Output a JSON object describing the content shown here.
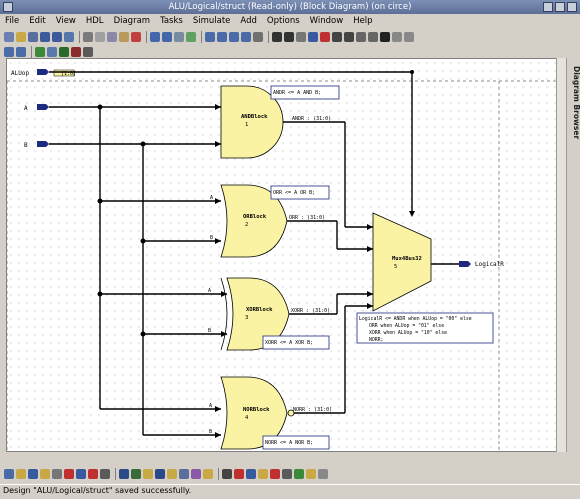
{
  "window": {
    "title": "ALU/Logical/struct (Read-only) (Block Diagram) (on circe)"
  },
  "menu": [
    "File",
    "Edit",
    "View",
    "HDL",
    "Diagram",
    "Tasks",
    "Simulate",
    "Add",
    "Options",
    "Window",
    "Help"
  ],
  "side_panel": {
    "label": "Diagram Browser"
  },
  "diagram": {
    "ports": {
      "aluop": {
        "label": "ALUop",
        "width": "[1:0]"
      },
      "a": {
        "label": "A"
      },
      "b": {
        "label": "B"
      },
      "out": {
        "label": "LogicalR"
      }
    },
    "blocks": [
      {
        "name": "ANDBlock",
        "num": "1",
        "out": "ANDR : (31:0)",
        "eq": "ANDR <= A AND B;"
      },
      {
        "name": "ORBlock",
        "num": "2",
        "out": "ORR : (31:0)",
        "eq": "ORR <= A OR B;"
      },
      {
        "name": "XORBlock",
        "num": "3",
        "out": "XORR : (31:0)",
        "eq": "XORR <= A XOR B;"
      },
      {
        "name": "NORBlock",
        "num": "4",
        "out": "NORR : (31:0)",
        "eq": "NORR <= A NOR B;"
      }
    ],
    "mux": {
      "name": "Mux4Bus32",
      "num": "5"
    },
    "pin_labels": {
      "a": "A",
      "b": "B"
    },
    "mux_code": [
      "LogicalR <= ANDR when ALUop = \"00\" else",
      "ORR when ALUop = \"01\" else",
      "XORR when ALUop = \"10\" else",
      "NORR;"
    ]
  },
  "status": {
    "message": "Design \"ALU/Logical/struct\" saved successfully."
  },
  "colors": {
    "block_fill": "#fbf3a4",
    "wire": "#000000",
    "port": "#1c2a80",
    "note_border": "#1c2a80"
  }
}
